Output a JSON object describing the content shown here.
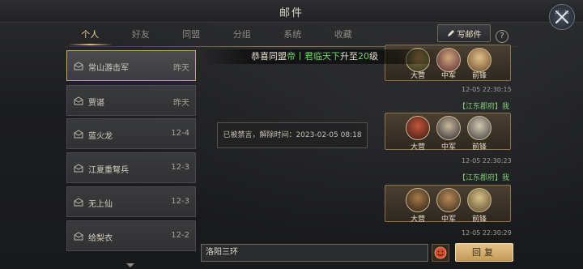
{
  "window": {
    "title": "邮件"
  },
  "tabs": [
    {
      "label": "个人",
      "active": true
    },
    {
      "label": "好友"
    },
    {
      "label": "同盟"
    },
    {
      "label": "分组"
    },
    {
      "label": "系统"
    },
    {
      "label": "收藏"
    }
  ],
  "toolbar": {
    "write_label": "写邮件",
    "help_label": "?"
  },
  "sidebar": {
    "items": [
      {
        "name": "常山游击军",
        "date": "昨天"
      },
      {
        "name": "贾谌",
        "date": "昨天"
      },
      {
        "name": "蓝火龙",
        "date": "12-4"
      },
      {
        "name": "江夏重弩兵",
        "date": "12-3"
      },
      {
        "name": "无上仙",
        "date": "12-3"
      },
      {
        "name": "给梨衣",
        "date": "12-2"
      }
    ]
  },
  "marquee": {
    "part1": "恭喜同盟",
    "part2": "帝丨君临天下",
    "part3": "升至",
    "part4": "20",
    "part5": "级"
  },
  "roles": {
    "camp": "大营",
    "middle": "中军",
    "vanguard": "前锋"
  },
  "messages": [
    {
      "timestamp": "12-05 22:30:15"
    },
    {
      "sender": "【江东郡府】我",
      "timestamp": "12-05 22:30:23"
    },
    {
      "sender": "【江东郡府】我",
      "timestamp": "12-05 22:30:29"
    }
  ],
  "notice": "已被禁言，解除时间：2023-02-05 08:18",
  "input": {
    "value": "洛阳三环"
  },
  "reply_label": "回复",
  "colors": {
    "accent_gold": "#e6bf64",
    "ally_green": "#73d36a",
    "card_border": "#8c7447"
  }
}
